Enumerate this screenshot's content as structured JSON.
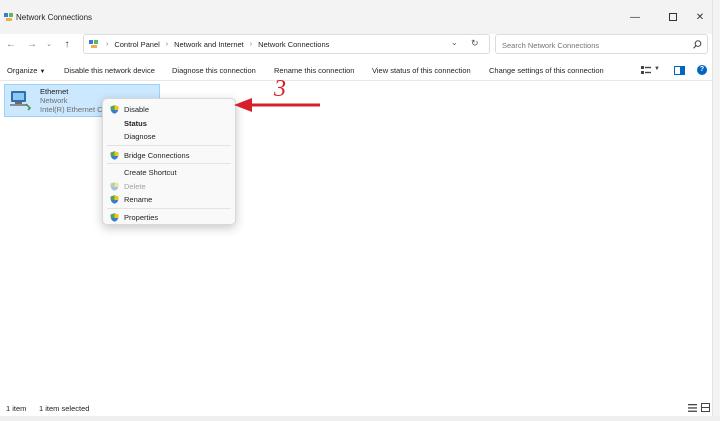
{
  "window": {
    "title": "Network Connections"
  },
  "address": {
    "crumbs": [
      "Control Panel",
      "Network and Internet",
      "Network Connections"
    ]
  },
  "search": {
    "placeholder": "Search Network Connections"
  },
  "commands": {
    "organize": "Organize",
    "disable_device": "Disable this network device",
    "diagnose": "Diagnose this connection",
    "rename": "Rename this connection",
    "view_status": "View status of this connection",
    "change_settings": "Change settings of this connection"
  },
  "item": {
    "name": "Ethernet",
    "type": "Network",
    "adapter": "Intel(R) Ethernet Co"
  },
  "context_menu": {
    "disable": "Disable",
    "status": "Status",
    "diagnose": "Diagnose",
    "bridge": "Bridge Connections",
    "shortcut": "Create Shortcut",
    "delete": "Delete",
    "rename": "Rename",
    "properties": "Properties"
  },
  "status_bar": {
    "count": "1 item",
    "selected": "1 item selected"
  },
  "annotation": {
    "step": "3"
  },
  "colors": {
    "accent": "#0067c0",
    "selection": "#cce8ff",
    "annotation": "#d6202a"
  }
}
